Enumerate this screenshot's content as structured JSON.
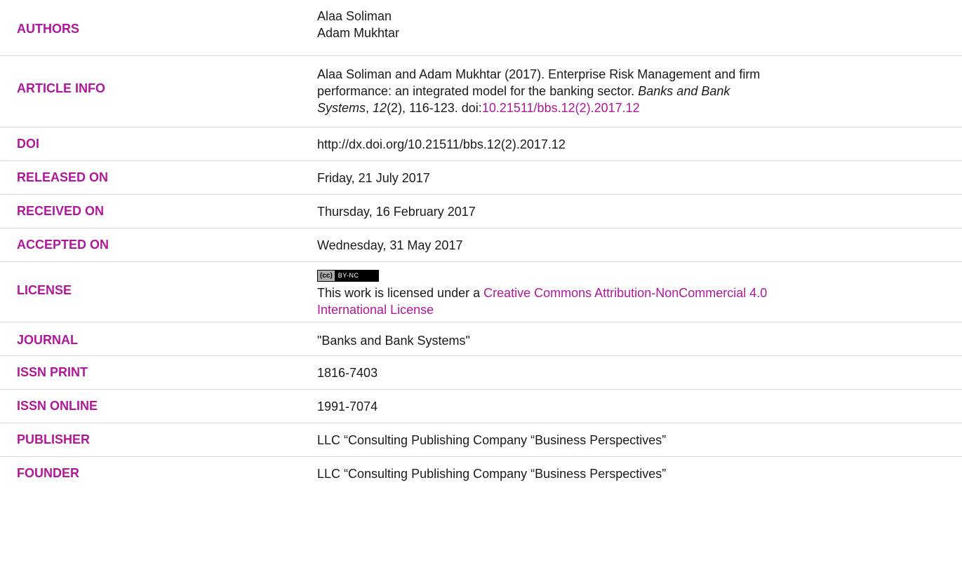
{
  "authors": {
    "label": "AUTHORS",
    "names": [
      "Alaa Soliman",
      "Adam Mukhtar"
    ]
  },
  "article_info": {
    "label": "ARTICLE INFO",
    "citation_line1": "Alaa Soliman and Adam Mukhtar (2017). Enterprise Risk Management and firm",
    "citation_line2_prefix": "performance: an integrated model for the banking sector. ",
    "journal_italic_1": "Banks and Bank",
    "journal_italic_2": "Systems",
    "line3_sep": ", ",
    "volume_italic": "12",
    "line3_rest": "(2), 116-123. doi:",
    "doi_link": "10.21511/bbs.12(2).2017.12"
  },
  "doi": {
    "label": "DOI",
    "value": "http://dx.doi.org/10.21511/bbs.12(2).2017.12"
  },
  "released_on": {
    "label": "RELEASED ON",
    "value": "Friday, 21 July 2017"
  },
  "received_on": {
    "label": "RECEIVED ON",
    "value": "Thursday, 16 February 2017"
  },
  "accepted_on": {
    "label": "ACCEPTED ON",
    "value": "Wednesday, 31 May 2017"
  },
  "license": {
    "label": "LICENSE",
    "badge_logo": "(cc)",
    "badge_terms": "BY-NC",
    "text_prefix": "This work is licensed under a ",
    "link_line1": "Creative Commons Attribution-NonCommercial 4.0",
    "link_line2": "International License"
  },
  "journal": {
    "label": "JOURNAL",
    "value": "\"Banks and Bank Systems\""
  },
  "issn_print": {
    "label": "ISSN PRINT",
    "value": "1816-7403"
  },
  "issn_online": {
    "label": "ISSN ONLINE",
    "value": "1991-7074"
  },
  "publisher": {
    "label": "PUBLISHER",
    "value": "LLC “Consulting Publishing Company “Business Perspectives”"
  },
  "founder": {
    "label": "FOUNDER",
    "value": "LLC “Consulting Publishing Company “Business Perspectives”"
  },
  "colors": {
    "accent": "#b0179b",
    "text": "#1a1a1a",
    "divider": "#d9d9d9"
  }
}
